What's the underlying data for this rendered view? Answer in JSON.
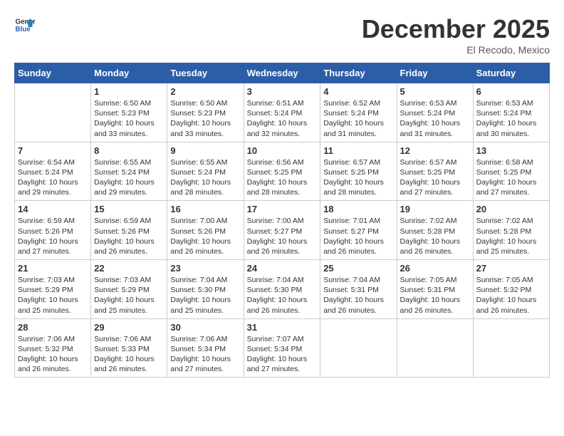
{
  "logo": {
    "text1": "General",
    "text2": "Blue"
  },
  "title": "December 2025",
  "location": "El Recodo, Mexico",
  "days_header": [
    "Sunday",
    "Monday",
    "Tuesday",
    "Wednesday",
    "Thursday",
    "Friday",
    "Saturday"
  ],
  "weeks": [
    [
      {
        "day": "",
        "info": ""
      },
      {
        "day": "1",
        "info": "Sunrise: 6:50 AM\nSunset: 5:23 PM\nDaylight: 10 hours\nand 33 minutes."
      },
      {
        "day": "2",
        "info": "Sunrise: 6:50 AM\nSunset: 5:23 PM\nDaylight: 10 hours\nand 33 minutes."
      },
      {
        "day": "3",
        "info": "Sunrise: 6:51 AM\nSunset: 5:24 PM\nDaylight: 10 hours\nand 32 minutes."
      },
      {
        "day": "4",
        "info": "Sunrise: 6:52 AM\nSunset: 5:24 PM\nDaylight: 10 hours\nand 31 minutes."
      },
      {
        "day": "5",
        "info": "Sunrise: 6:53 AM\nSunset: 5:24 PM\nDaylight: 10 hours\nand 31 minutes."
      },
      {
        "day": "6",
        "info": "Sunrise: 6:53 AM\nSunset: 5:24 PM\nDaylight: 10 hours\nand 30 minutes."
      }
    ],
    [
      {
        "day": "7",
        "info": "Sunrise: 6:54 AM\nSunset: 5:24 PM\nDaylight: 10 hours\nand 29 minutes."
      },
      {
        "day": "8",
        "info": "Sunrise: 6:55 AM\nSunset: 5:24 PM\nDaylight: 10 hours\nand 29 minutes."
      },
      {
        "day": "9",
        "info": "Sunrise: 6:55 AM\nSunset: 5:24 PM\nDaylight: 10 hours\nand 28 minutes."
      },
      {
        "day": "10",
        "info": "Sunrise: 6:56 AM\nSunset: 5:25 PM\nDaylight: 10 hours\nand 28 minutes."
      },
      {
        "day": "11",
        "info": "Sunrise: 6:57 AM\nSunset: 5:25 PM\nDaylight: 10 hours\nand 28 minutes."
      },
      {
        "day": "12",
        "info": "Sunrise: 6:57 AM\nSunset: 5:25 PM\nDaylight: 10 hours\nand 27 minutes."
      },
      {
        "day": "13",
        "info": "Sunrise: 6:58 AM\nSunset: 5:25 PM\nDaylight: 10 hours\nand 27 minutes."
      }
    ],
    [
      {
        "day": "14",
        "info": "Sunrise: 6:59 AM\nSunset: 5:26 PM\nDaylight: 10 hours\nand 27 minutes."
      },
      {
        "day": "15",
        "info": "Sunrise: 6:59 AM\nSunset: 5:26 PM\nDaylight: 10 hours\nand 26 minutes."
      },
      {
        "day": "16",
        "info": "Sunrise: 7:00 AM\nSunset: 5:26 PM\nDaylight: 10 hours\nand 26 minutes."
      },
      {
        "day": "17",
        "info": "Sunrise: 7:00 AM\nSunset: 5:27 PM\nDaylight: 10 hours\nand 26 minutes."
      },
      {
        "day": "18",
        "info": "Sunrise: 7:01 AM\nSunset: 5:27 PM\nDaylight: 10 hours\nand 26 minutes."
      },
      {
        "day": "19",
        "info": "Sunrise: 7:02 AM\nSunset: 5:28 PM\nDaylight: 10 hours\nand 26 minutes."
      },
      {
        "day": "20",
        "info": "Sunrise: 7:02 AM\nSunset: 5:28 PM\nDaylight: 10 hours\nand 25 minutes."
      }
    ],
    [
      {
        "day": "21",
        "info": "Sunrise: 7:03 AM\nSunset: 5:29 PM\nDaylight: 10 hours\nand 25 minutes."
      },
      {
        "day": "22",
        "info": "Sunrise: 7:03 AM\nSunset: 5:29 PM\nDaylight: 10 hours\nand 25 minutes."
      },
      {
        "day": "23",
        "info": "Sunrise: 7:04 AM\nSunset: 5:30 PM\nDaylight: 10 hours\nand 25 minutes."
      },
      {
        "day": "24",
        "info": "Sunrise: 7:04 AM\nSunset: 5:30 PM\nDaylight: 10 hours\nand 26 minutes."
      },
      {
        "day": "25",
        "info": "Sunrise: 7:04 AM\nSunset: 5:31 PM\nDaylight: 10 hours\nand 26 minutes."
      },
      {
        "day": "26",
        "info": "Sunrise: 7:05 AM\nSunset: 5:31 PM\nDaylight: 10 hours\nand 26 minutes."
      },
      {
        "day": "27",
        "info": "Sunrise: 7:05 AM\nSunset: 5:32 PM\nDaylight: 10 hours\nand 26 minutes."
      }
    ],
    [
      {
        "day": "28",
        "info": "Sunrise: 7:06 AM\nSunset: 5:32 PM\nDaylight: 10 hours\nand 26 minutes."
      },
      {
        "day": "29",
        "info": "Sunrise: 7:06 AM\nSunset: 5:33 PM\nDaylight: 10 hours\nand 26 minutes."
      },
      {
        "day": "30",
        "info": "Sunrise: 7:06 AM\nSunset: 5:34 PM\nDaylight: 10 hours\nand 27 minutes."
      },
      {
        "day": "31",
        "info": "Sunrise: 7:07 AM\nSunset: 5:34 PM\nDaylight: 10 hours\nand 27 minutes."
      },
      {
        "day": "",
        "info": ""
      },
      {
        "day": "",
        "info": ""
      },
      {
        "day": "",
        "info": ""
      }
    ]
  ]
}
